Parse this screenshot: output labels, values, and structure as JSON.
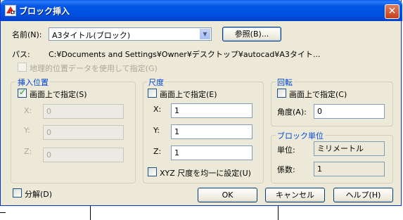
{
  "window": {
    "title": "ブロック挿入",
    "close_glyph": "✕"
  },
  "name_row": {
    "label": "名前(N):",
    "value": "A3タイトル(ブロック)",
    "browse_button": "参照(B)..."
  },
  "path_row": {
    "label": "パス:",
    "value": "C:¥Documents and Settings¥Owner¥デスクトップ¥autocad¥A3タイト..."
  },
  "geo_checkbox": {
    "label": "地理的位置データを使用して指定(G)",
    "checked": false
  },
  "insertion": {
    "title": "挿入位置",
    "on_screen_label": "画面上で指定(S)",
    "on_screen_checked": true,
    "x_label": "X:",
    "x_value": "0",
    "y_label": "Y:",
    "y_value": "0",
    "z_label": "Z:",
    "z_value": "0"
  },
  "scale": {
    "title": "尺度",
    "on_screen_label": "画面上で指定(E)",
    "on_screen_checked": false,
    "x_label": "X:",
    "x_value": "1",
    "y_label": "Y:",
    "y_value": "1",
    "z_label": "Z:",
    "z_value": "1",
    "uniform_label": "XYZ 尺度を均一に設定(U)",
    "uniform_checked": false
  },
  "rotation": {
    "title": "回転",
    "on_screen_label": "画面上で指定(C)",
    "on_screen_checked": false,
    "angle_label": "角度(A):",
    "angle_value": "0"
  },
  "block_unit": {
    "title": "ブロック単位",
    "unit_label": "単位:",
    "unit_value": "ミリメートル",
    "factor_label": "係数:",
    "factor_value": "1"
  },
  "explode": {
    "label": "分解(D)",
    "checked": false
  },
  "buttons": {
    "ok": "OK",
    "cancel": "キャンセル",
    "help": "ヘルプ(H)"
  },
  "colors": {
    "title_bar": "#0055e5",
    "dialog_bg": "#ece9d8",
    "group_title": "#0046d5"
  }
}
